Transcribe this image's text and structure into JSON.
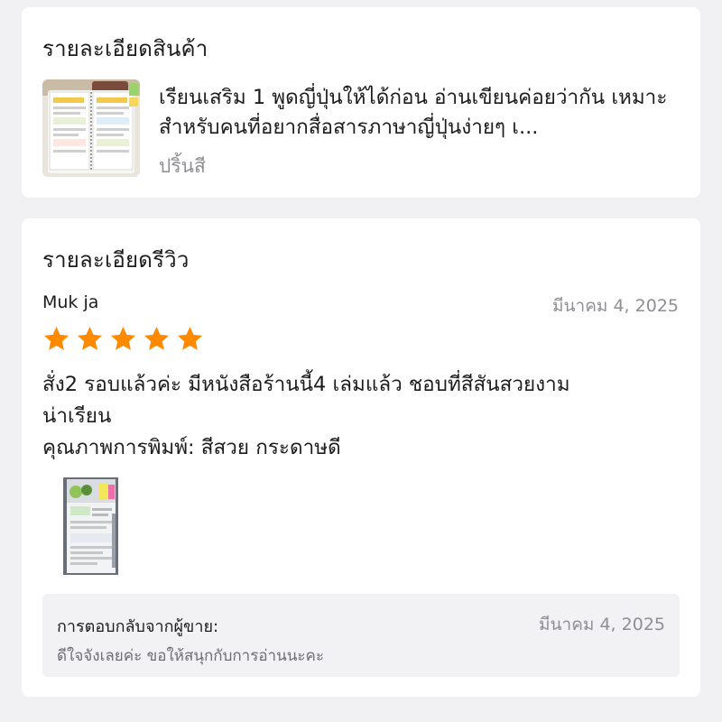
{
  "product_section": {
    "title": "รายละเอียดสินค้า",
    "product_name": "เรียนเสริม 1 พูดญี่ปุ่นให้ได้ก่อน อ่านเขียนค่อยว่ากัน เหมาะสำหรับคนที่อยากสื่อสารภาษาญี่ปุ่นง่ายๆ เ...",
    "variant": "ปริ้นสี"
  },
  "review_section": {
    "title": "รายละเอียดรีวิว",
    "reviewer": "Muk ja",
    "date": "มีนาคม 4, 2025",
    "rating": 5,
    "star_color": "#ff8a00",
    "text_lines": [
      "สั่ง2 รอบแล้วค่ะ  มีหนังสือร้านนี้4 เล่มแล้ว ชอบที่สีสันสวยงาม",
      "น่าเรียน",
      "คุณภาพการพิมพ์: สีสวย กระดาษดี"
    ]
  },
  "seller_reply": {
    "label": "การตอบกลับจากผู้ขาย:",
    "date": "มีนาคม 4, 2025",
    "text": "ดีใจจังเลยค่ะ ขอให้สนุกกับการอ่านนะคะ"
  }
}
